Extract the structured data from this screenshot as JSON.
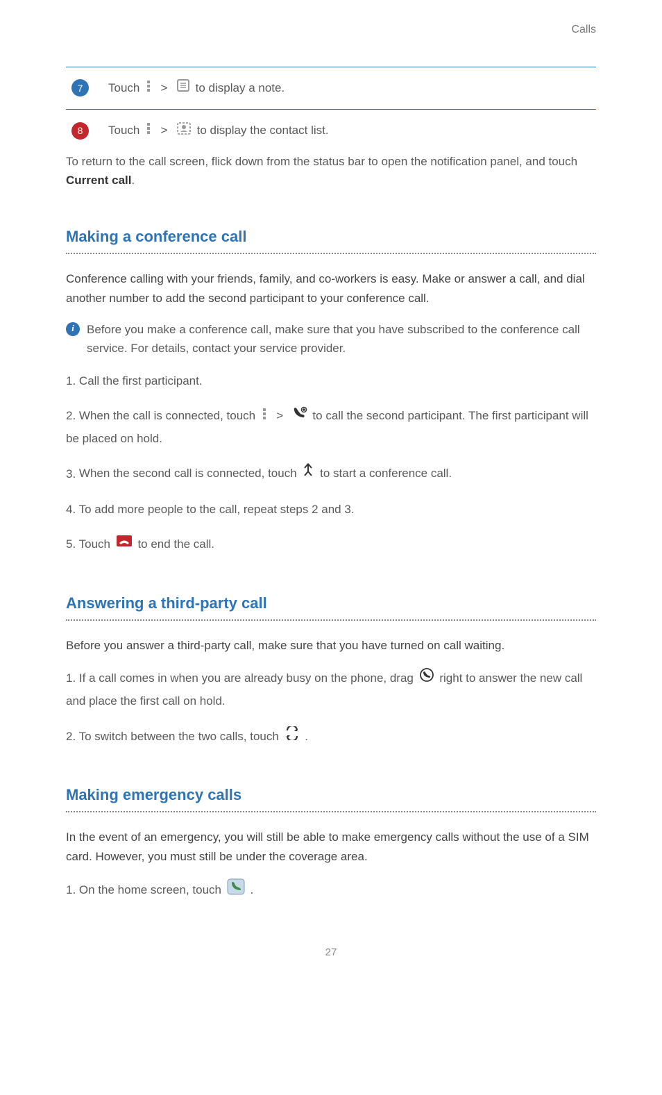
{
  "header": {
    "section": "Calls"
  },
  "table": {
    "row7": {
      "num": "7",
      "pre": "Touch ",
      "post": " to display a note."
    },
    "row8": {
      "num": "8",
      "pre": "Touch ",
      "post": " to display the contact list."
    }
  },
  "return_text": {
    "pre": "To return to the call screen, flick down from the status bar to open the notification panel, and touch ",
    "bold": "Current call",
    "post": "."
  },
  "section_conf": {
    "title": "Making a conference call",
    "intro": "Conference calling with your friends, family, and co-workers is easy. Make or answer a call, and dial another number to add the second participant to your conference call.",
    "note": "Before you make a conference call, make sure that you have subscribed to the conference call service. For details, contact your service provider.",
    "steps": {
      "s1": "Call the first participant.",
      "s2_pre": "When the call is connected, touch ",
      "s2_post": " to call the second participant. The first participant will be placed on hold.",
      "s3_pre": "When the second call is connected, touch ",
      "s3_post": " to start a conference call.",
      "s4": "To add more people to the call, repeat steps 2 and 3.",
      "s5_pre": "Touch ",
      "s5_post": " to end the call."
    }
  },
  "section_third": {
    "title": "Answering a third-party call",
    "intro": "Before you answer a third-party call, make sure that you have turned on call waiting.",
    "steps": {
      "s1_pre": "If a call comes in when you are already busy on the phone, drag ",
      "s1_post": " right to answer the new call and place the first call on hold.",
      "s2_pre": "To switch between the two calls, touch ",
      "s2_post": " ."
    }
  },
  "section_emerg": {
    "title": "Making emergency calls",
    "intro": "In the event of an emergency, you will still be able to make emergency calls without the use of a SIM card. However, you must still be under the coverage area.",
    "steps": {
      "s1_pre": "On the home screen, touch ",
      "s1_post": " ."
    }
  },
  "page": "27"
}
